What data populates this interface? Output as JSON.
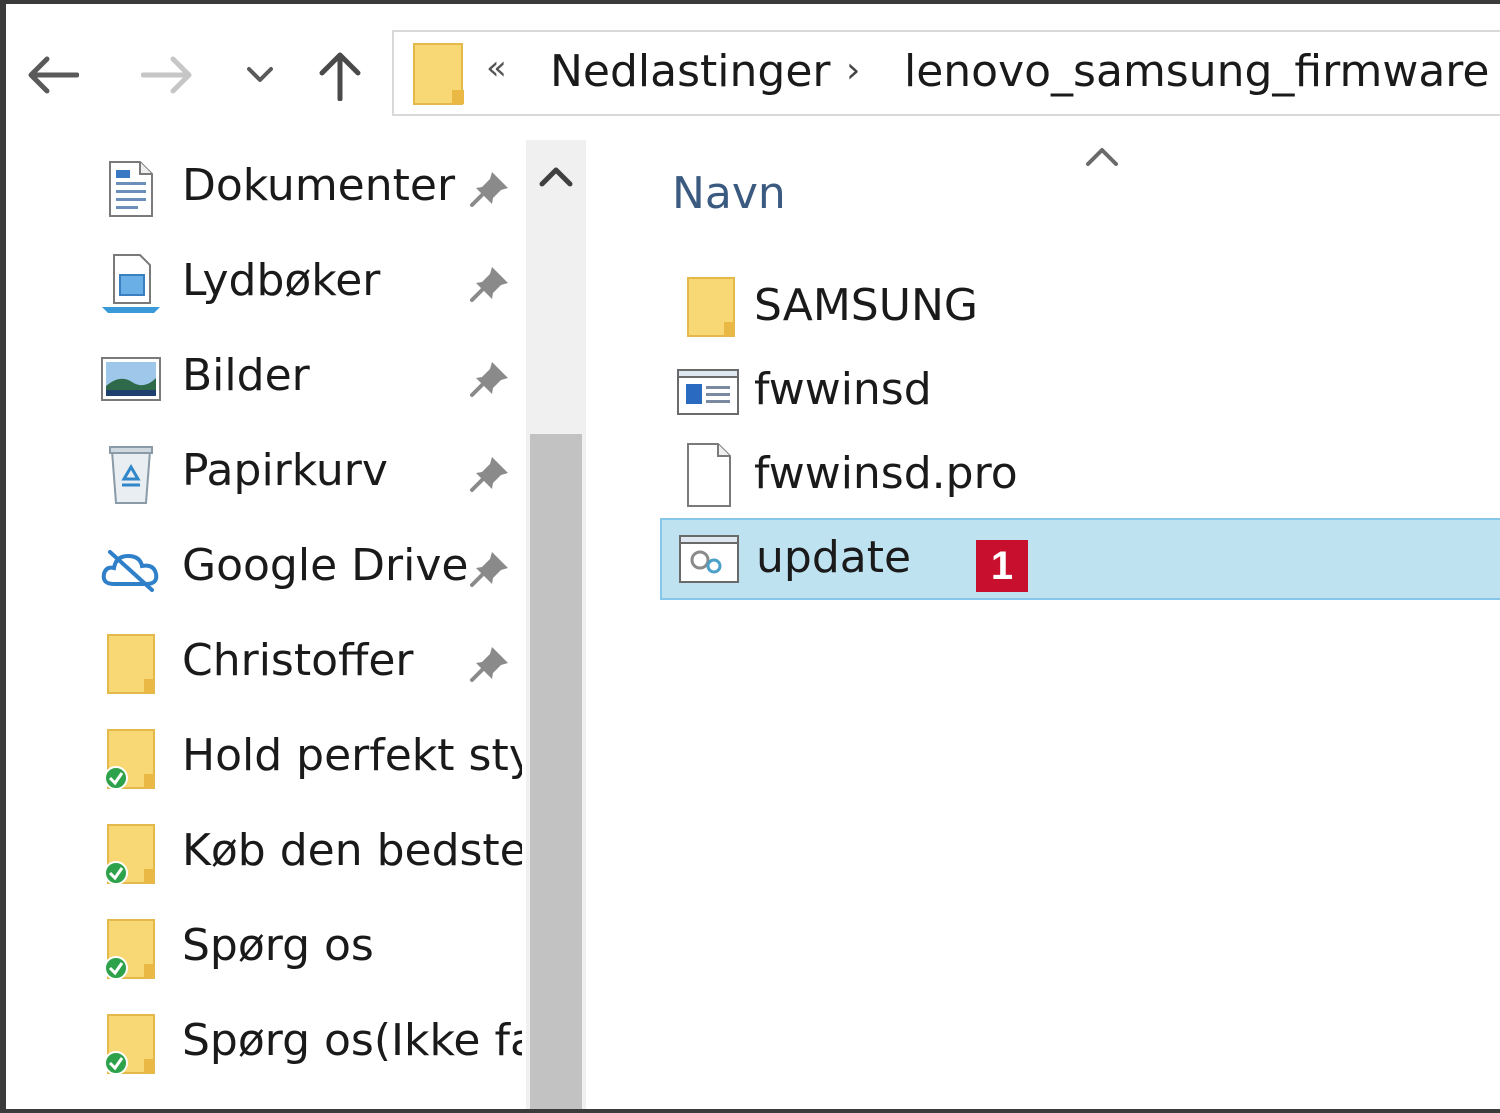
{
  "navigation": {
    "back_icon": "arrow-left-icon",
    "forward_icon": "arrow-right-icon",
    "recent_icon": "chevron-down-icon",
    "up_icon": "arrow-up-icon"
  },
  "addressbar": {
    "overflow_chevron": "«",
    "separator": "›",
    "breadcrumbs": [
      "Nedlastinger",
      "lenovo_samsung_firmware"
    ]
  },
  "sidebar": {
    "items": [
      {
        "label": "Dokumenter",
        "icon": "documents-icon",
        "pinned": true
      },
      {
        "label": "Lydbøker",
        "icon": "audiobooks-icon",
        "pinned": true
      },
      {
        "label": "Bilder",
        "icon": "pictures-icon",
        "pinned": true
      },
      {
        "label": "Papirkurv",
        "icon": "recycle-bin-icon",
        "pinned": true
      },
      {
        "label": "Google Drive",
        "icon": "google-drive-icon",
        "pinned": true
      },
      {
        "label": "Christoffer",
        "icon": "folder-icon",
        "pinned": true
      },
      {
        "label": "Hold perfekt styr",
        "icon": "synced-folder-icon",
        "pinned": false
      },
      {
        "label": "Køb den bedste",
        "icon": "synced-folder-icon",
        "pinned": false
      },
      {
        "label": "Spørg os",
        "icon": "synced-folder-icon",
        "pinned": false
      },
      {
        "label": "Spørg os(Ikke fæ",
        "icon": "synced-folder-icon",
        "pinned": false
      }
    ]
  },
  "content": {
    "column_header": "Navn",
    "files": [
      {
        "name": "SAMSUNG",
        "icon": "folder-icon",
        "selected": false
      },
      {
        "name": "fwwinsd",
        "icon": "application-icon",
        "selected": false
      },
      {
        "name": "fwwinsd.pro",
        "icon": "file-icon",
        "selected": false
      },
      {
        "name": "update",
        "icon": "batch-file-icon",
        "selected": true,
        "badge": "1"
      }
    ]
  },
  "colors": {
    "selection": "#bfe2f1",
    "selection_border": "#86c6e8",
    "badge": "#c8102e",
    "header_text": "#3a5a80",
    "folder": "#f8d775"
  }
}
